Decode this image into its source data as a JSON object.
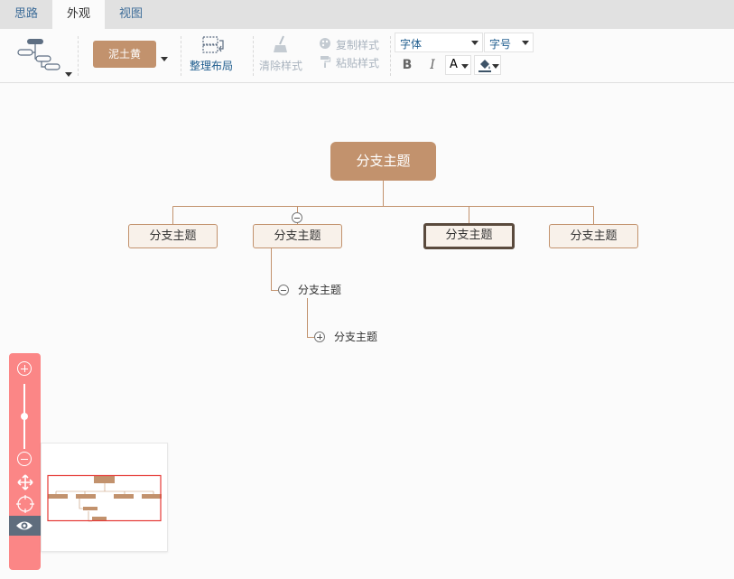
{
  "tabs": [
    {
      "label": "思路",
      "active": false
    },
    {
      "label": "外观",
      "active": true
    },
    {
      "label": "视图",
      "active": false
    }
  ],
  "toolbar": {
    "layout_icon": "structure-icon",
    "theme_label": "泥土黄",
    "arrange_label": "整理布局",
    "clear_style_label": "清除样式",
    "copy_style_label": "复制样式",
    "paste_style_label": "粘贴样式",
    "font_placeholder": "字体",
    "fontsize_placeholder": "字号",
    "bold_label": "B",
    "italic_label": "I",
    "font_color_label": "A"
  },
  "mindmap": {
    "root": "分支主题",
    "branches": [
      "分支主题",
      "分支主题",
      "分支主题",
      "分支主题"
    ],
    "sub1": "分支主题",
    "sub2": "分支主题"
  },
  "colors": {
    "accent": "#c2926d",
    "node_fill": "#f8f1ea",
    "selected_border": "#5a4a3d",
    "zoom_panel": "#fb8686",
    "tab_link": "#3e6d99"
  },
  "zoom": {
    "level_fraction": 0.5
  }
}
